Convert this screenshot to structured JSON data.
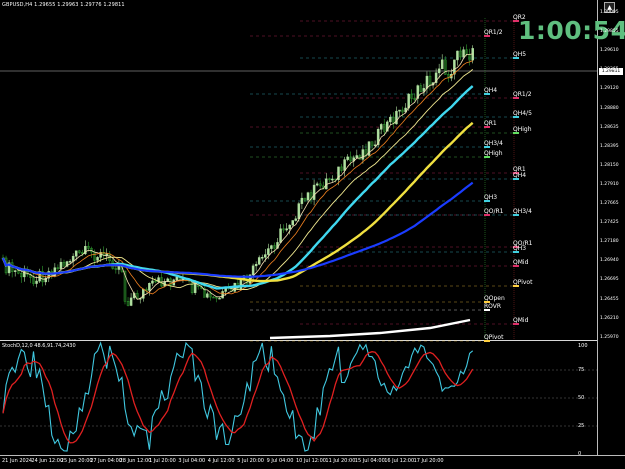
{
  "window": {
    "symbol_label": "GBPUSD,H4",
    "ohlc": "1.29655 1.29963 1.29776 1.29811"
  },
  "countdown": "1:00:54",
  "oscillator": {
    "label": "StochD,12,0 48.6,91.74,2430"
  },
  "scroll_button": "▲",
  "price_box": "1.29811",
  "price_ticks": [
    "1.30095",
    "1.29855",
    "1.29610",
    "1.29365",
    "1.29120",
    "1.28880",
    "1.28635",
    "1.28395",
    "1.28150",
    "1.27910",
    "1.27665",
    "1.27425",
    "1.27180",
    "1.26940",
    "1.26695",
    "1.26455",
    "1.26210",
    "1.25970"
  ],
  "osc_ticks": [
    "100",
    "75",
    "50",
    "25",
    "0"
  ],
  "time_ticks": [
    "21 Jun 2024",
    "24 Jun 12:00",
    "25 Jun 20:00",
    "27 Jun 04:00",
    "28 Jun 12:00",
    "1 Jul 20:00",
    "3 Jul 04:00",
    "4 Jul 12:00",
    "5 Jul 20:00",
    "9 Jul 04:00",
    "10 Jul 12:00",
    "11 Jul 20:00",
    "15 Jul 04:00",
    "16 Jul 12:00",
    "17 Jul 20:00"
  ],
  "levels": [
    {
      "text": "QR2",
      "color": "#e0306a"
    },
    {
      "text": "QR1/2",
      "color": "#e0306a"
    },
    {
      "text": "QH5",
      "color": "#40d0e0"
    },
    {
      "text": "QH4",
      "color": "#40d0e0"
    },
    {
      "text": "QR1/2",
      "color": "#e0306a"
    },
    {
      "text": "QH4/5",
      "color": "#40d0e0"
    },
    {
      "text": "QR1",
      "color": "#e0306a"
    },
    {
      "text": "QHigh",
      "color": "#60e060"
    },
    {
      "text": "QH3/4",
      "color": "#40d0e0"
    },
    {
      "text": "QHigh",
      "color": "#60e060"
    },
    {
      "text": "QR1",
      "color": "#e0306a"
    },
    {
      "text": "QH4",
      "color": "#40d0e0"
    },
    {
      "text": "QH3",
      "color": "#40d0e0"
    },
    {
      "text": "QO/R1",
      "color": "#e0306a"
    },
    {
      "text": "QH3/4",
      "color": "#40d0e0"
    },
    {
      "text": "QO/R1",
      "color": "#e0306a"
    },
    {
      "text": "QH3",
      "color": "#40d0e0"
    },
    {
      "text": "QMid",
      "color": "#e0306a"
    },
    {
      "text": "QPivot",
      "color": "#ffd040"
    },
    {
      "text": "QOpen",
      "color": "#ffd040"
    },
    {
      "text": "ROVR",
      "color": "#ffffff"
    },
    {
      "text": "QMid",
      "color": "#e0306a"
    },
    {
      "text": "QPivot",
      "color": "#ffd040"
    }
  ],
  "colors": {
    "bull_candle": "#b0e0a0",
    "bear_candle": "#30a030",
    "ma_blue": "#1a3cff",
    "ma_cyan": "#40d8f0",
    "ma_yellow": "#f0e040",
    "ma_orange": "#f08020",
    "ma_white": "#ffffff",
    "stoch_main": "#40c8e0",
    "stoch_signal": "#e02020"
  }
}
